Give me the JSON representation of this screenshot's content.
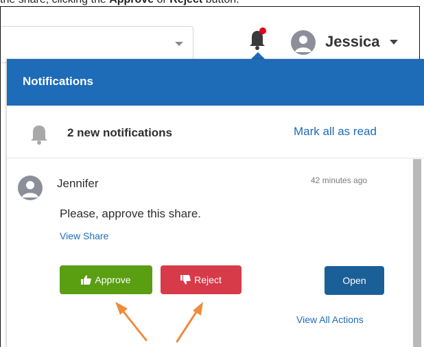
{
  "caption": {
    "prefix": "the share, clicking the ",
    "approve_word": "Approve",
    "middle": " or ",
    "reject_word": "Reject",
    "suffix": " button."
  },
  "header": {
    "user_name": "Jessica",
    "bell_icon": "bell-icon",
    "bell_badge_color": "#e3001b"
  },
  "notifications": {
    "title": "Notifications",
    "summary": "2 new notifications",
    "mark_all": "Mark all as read",
    "item": {
      "sender": "Jennifer",
      "time": "42 minutes ago",
      "message": "Please, approve this share.",
      "view_link": "View Share",
      "approve_label": "Approve",
      "reject_label": "Reject",
      "open_label": "Open",
      "view_all": "View All Actions"
    }
  },
  "colors": {
    "header_blue": "#1e6bb8",
    "approve_green": "#5a9e12",
    "reject_red": "#d73a49",
    "open_blue": "#1a5f98",
    "annotation_arrow": "#f08a3c"
  }
}
